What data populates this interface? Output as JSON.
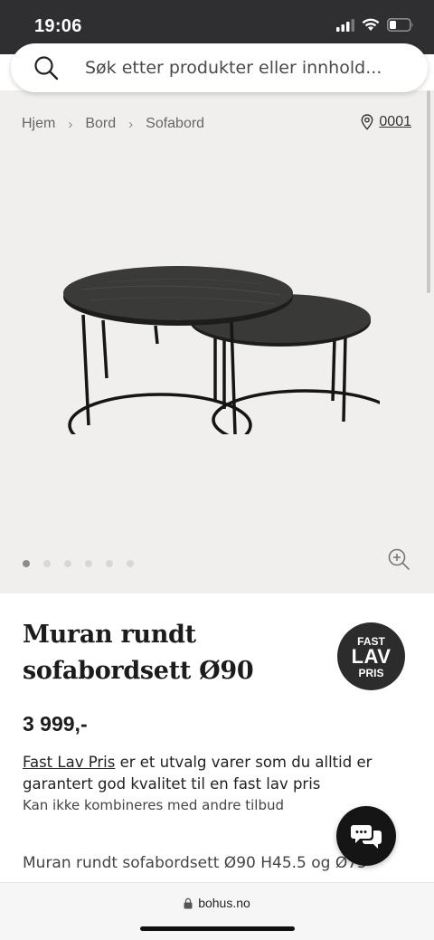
{
  "status_bar": {
    "time": "19:06",
    "icons": [
      "signal-icon",
      "wifi-icon",
      "battery-icon"
    ]
  },
  "search": {
    "placeholder": "Søk etter produkter eller innhold..."
  },
  "breadcrumb": {
    "items": [
      "Hjem",
      "Bord",
      "Sofabord"
    ]
  },
  "store": {
    "label": "0001"
  },
  "gallery": {
    "image_count": 6,
    "active_index": 0
  },
  "product": {
    "title": "Muran rundt sofabordsett Ø90",
    "price": "3 999,-",
    "badge": {
      "top": "FAST",
      "mid": "LAV",
      "bottom": "PRIS"
    },
    "description_link": "Fast Lav Pris",
    "description_rest": " er et utvalg varer som du alltid er garantert god kvalitet til en fast lav pris",
    "note": "Kan ikke kombineres med andre tilbud",
    "specs": "Muran rundt sofabordsett Ø90 H45.5 og Ø75"
  },
  "browser": {
    "url": "bohus.no"
  },
  "colors": {
    "status_bg": "#2f2f31",
    "gallery_bg": "#f1efed",
    "badge_bg": "#2c2c2c",
    "chat_bg": "#151515"
  }
}
